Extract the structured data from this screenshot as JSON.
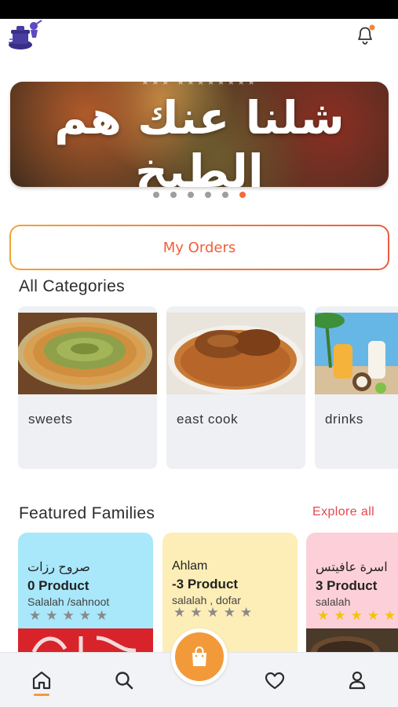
{
  "banner": {
    "text": "شلنا عنك هم الطبخ",
    "slides": 6,
    "active_slide": 6
  },
  "orders": {
    "label": "My Orders"
  },
  "categories": {
    "title": "All Categories",
    "items": [
      {
        "label": "sweets"
      },
      {
        "label": "east cook"
      },
      {
        "label": "drinks"
      }
    ]
  },
  "families": {
    "title": "Featured Families",
    "explore_label": "Explore all",
    "items": [
      {
        "name": "صروح رزات",
        "count": "0 Product",
        "location": "Salalah /sahnoot",
        "rating": 0,
        "color": "#a9e7fb"
      },
      {
        "name": "Ahlam",
        "count": "-3 Product",
        "location": "salalah , dofar",
        "rating": 0,
        "color": "#fdeeb7"
      },
      {
        "name": "اسرة عافيتس",
        "count": "3 Product",
        "location": "salalah",
        "rating": 5,
        "color": "#fdd0d9"
      }
    ]
  },
  "nav": {
    "items": [
      "home-icon",
      "search-icon",
      "cart-icon",
      "heart-icon",
      "profile-icon"
    ],
    "active": "home-icon",
    "accent": "#f29a3a"
  },
  "colors": {
    "accent_orange": "#f29a3a",
    "explore_red": "#e5484d",
    "orders_text": "#ef5f3a"
  }
}
